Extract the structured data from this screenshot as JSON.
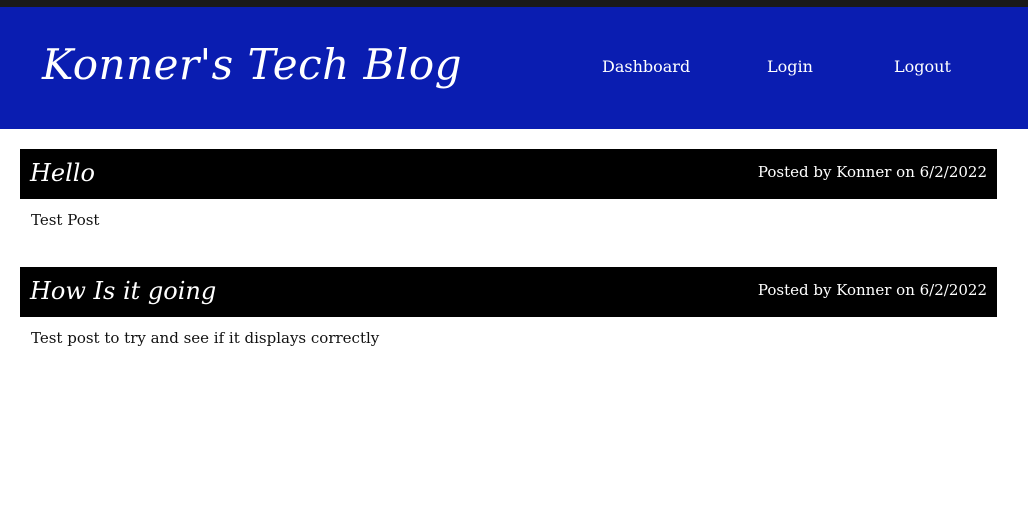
{
  "header": {
    "site_title": "Konner's Tech Blog",
    "nav": {
      "dashboard": "Dashboard",
      "login": "Login",
      "logout": "Logout"
    }
  },
  "posts": [
    {
      "title": "Hello",
      "meta": "Posted by Konner on 6/2/2022",
      "body": "Test Post"
    },
    {
      "title": "How Is it going",
      "meta": "Posted by Konner on 6/2/2022",
      "body": "Test post to try and see if it displays correctly"
    }
  ],
  "colors": {
    "header_background": "#0a1db1",
    "post_header_background": "#000000",
    "top_strip": "#1a1a1a"
  }
}
